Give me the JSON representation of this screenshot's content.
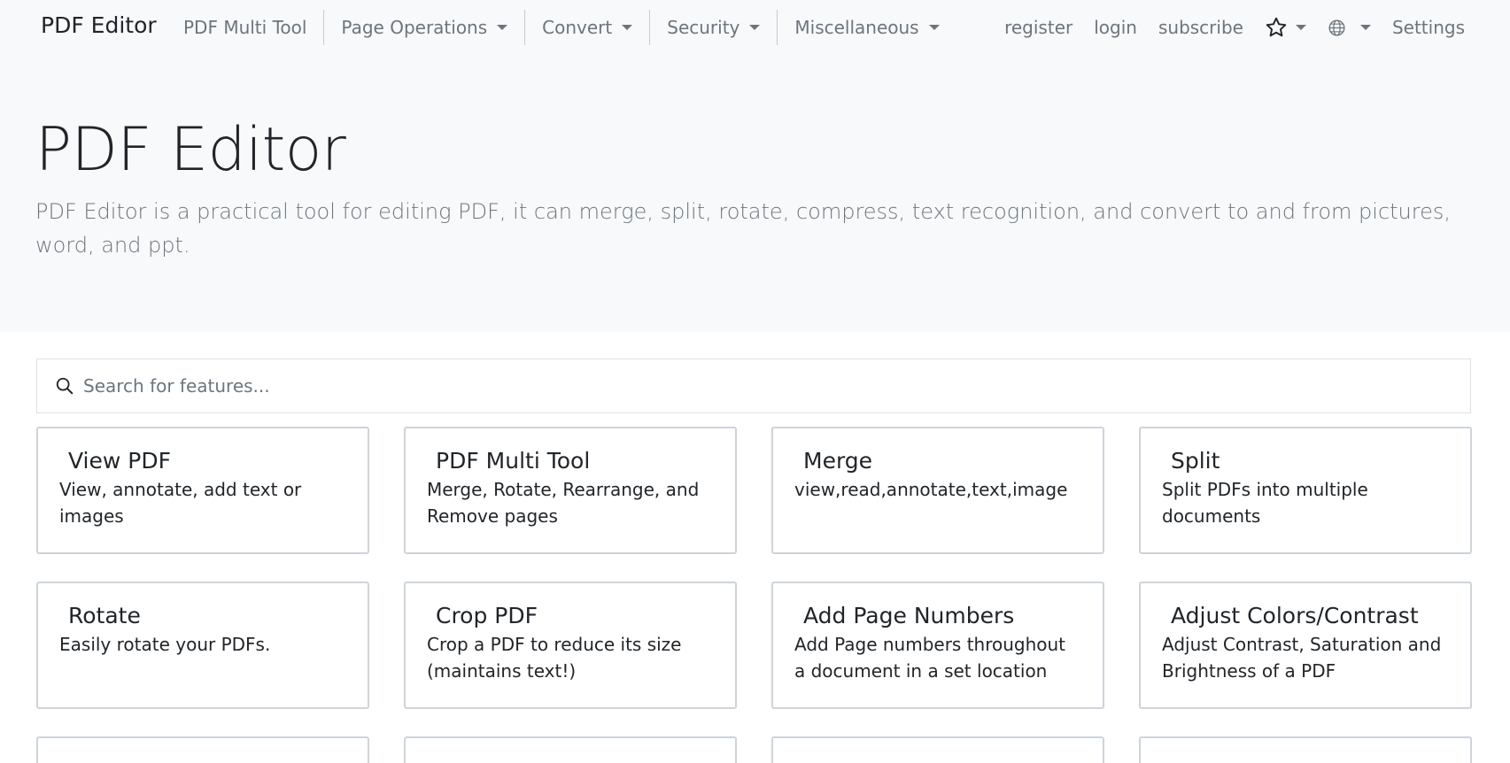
{
  "navbar": {
    "brand": "PDF Editor",
    "items": [
      {
        "label": "PDF Multi Tool",
        "dropdown": false
      },
      {
        "label": "Page Operations",
        "dropdown": true
      },
      {
        "label": "Convert",
        "dropdown": true
      },
      {
        "label": "Security",
        "dropdown": true
      },
      {
        "label": "Miscellaneous",
        "dropdown": true
      }
    ],
    "right": {
      "register": "register",
      "login": "login",
      "subscribe": "subscribe",
      "favorites_icon": "star-icon",
      "language_icon": "globe-icon",
      "settings": "Settings"
    }
  },
  "hero": {
    "title": "PDF Editor",
    "lead": "PDF Editor is a practical tool for editing PDF, it can merge, split, rotate, compress, text recognition, and convert to and from pictures, word, and ppt."
  },
  "search": {
    "placeholder": "Search for features...",
    "value": ""
  },
  "cards": [
    {
      "title": "View PDF",
      "desc": "View, annotate, add text or images"
    },
    {
      "title": "PDF Multi Tool",
      "desc": "Merge, Rotate, Rearrange, and Remove pages"
    },
    {
      "title": "Merge",
      "desc": "view,read,annotate,text,image"
    },
    {
      "title": "Split",
      "desc": "Split PDFs into multiple documents"
    },
    {
      "title": "Rotate",
      "desc": "Easily rotate your PDFs."
    },
    {
      "title": "Crop PDF",
      "desc": "Crop a PDF to reduce its size (maintains text!)"
    },
    {
      "title": "Add Page Numbers",
      "desc": "Add Page numbers throughout a document in a set location"
    },
    {
      "title": "Adjust Colors/Contrast",
      "desc": "Adjust Contrast, Saturation and Brightness of a PDF"
    }
  ],
  "colors": {
    "navbar_bg": "#f8f9fa",
    "muted_text": "#6c757d",
    "card_border": "#ced4da"
  }
}
